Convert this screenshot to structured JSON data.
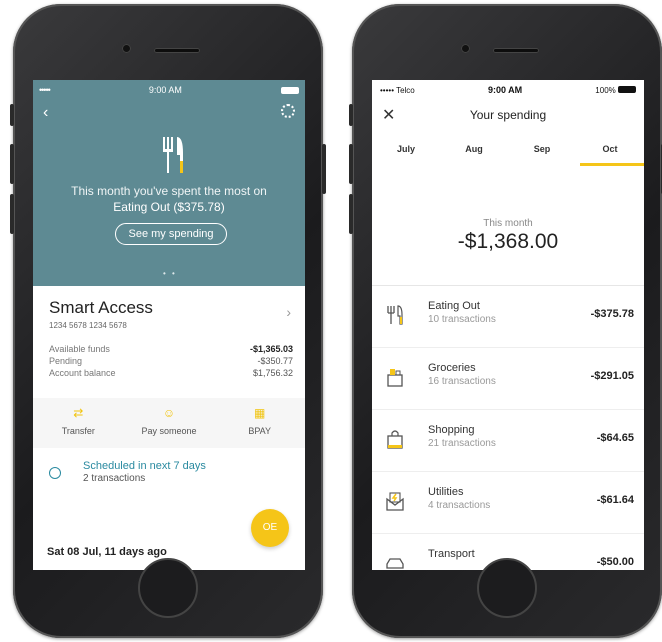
{
  "left_phone": {
    "status": {
      "signal": "•••••",
      "time": "9:00 AM"
    },
    "hero": {
      "message_prefix": "This month you've spent the most on",
      "category": "Eating Out",
      "amount": "($375.78)",
      "button": "See my spending",
      "pager": "• •"
    },
    "account": {
      "name": "Smart Access",
      "number": "1234 5678 1234 5678",
      "rows": [
        {
          "label": "Available funds",
          "value": "-$1,365.03"
        },
        {
          "label": "Pending",
          "value": "-$350.77"
        },
        {
          "label": "Account balance",
          "value": "$1,756.32"
        }
      ]
    },
    "actions": [
      {
        "label": "Transfer",
        "icon": "transfer-icon"
      },
      {
        "label": "Pay someone",
        "icon": "person-icon"
      },
      {
        "label": "BPAY",
        "icon": "bpay-icon"
      }
    ],
    "scheduled": {
      "title": "Scheduled in next 7 days",
      "subtitle": "2 transactions"
    },
    "fab_label": "OE",
    "date_header": "Sat 08 Jul, 11 days ago",
    "colors": {
      "hero": "#5e8a93",
      "accent": "#f5c518",
      "link": "#2a8aa0"
    }
  },
  "right_phone": {
    "status": {
      "carrier": "••••• Telco",
      "time": "9:00 AM",
      "battery": "100%"
    },
    "title": "Your spending",
    "months": [
      "July",
      "Aug",
      "Sep",
      "Oct"
    ],
    "active_month": "Oct",
    "this_month_label": "This month",
    "total": "-$1,368.00",
    "categories": [
      {
        "name": "Eating Out",
        "sub": "10 transactions",
        "amount": "-$375.78",
        "icon": "cutlery-icon"
      },
      {
        "name": "Groceries",
        "sub": "16 transactions",
        "amount": "-$291.05",
        "icon": "groceries-icon"
      },
      {
        "name": "Shopping",
        "sub": "21 transactions",
        "amount": "-$64.65",
        "icon": "shopping-bag-icon"
      },
      {
        "name": "Utilities",
        "sub": "4 transactions",
        "amount": "-$61.64",
        "icon": "utilities-icon"
      },
      {
        "name": "Transport",
        "sub": "",
        "amount": "-$50.00",
        "icon": "car-icon"
      }
    ]
  }
}
